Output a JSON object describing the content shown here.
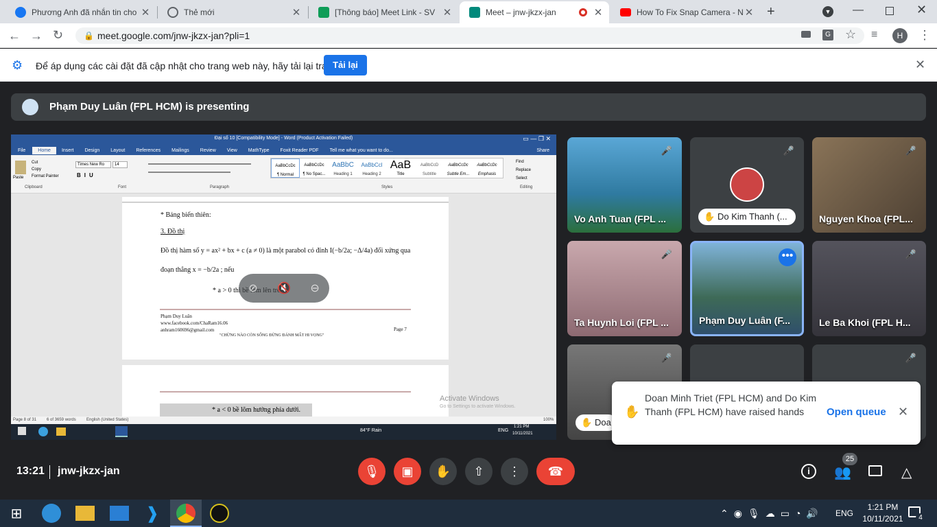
{
  "browser": {
    "tabs": [
      {
        "label": "Phương Anh đã nhắn tin cho",
        "color": "#1877f2"
      },
      {
        "label": "Thẻ mới",
        "color": "#5f6368"
      },
      {
        "label": "[Thông báo] Meet Link - SV",
        "color": "#0f9d58"
      },
      {
        "label": "Meet – jnw-jkzx-jan",
        "color": "#00897b"
      },
      {
        "label": "How To Fix Snap Camera - No",
        "color": "#ff0000"
      }
    ],
    "url": "meet.google.com/jnw-jkzx-jan?pli=1",
    "profile": "H"
  },
  "infobar": {
    "message": "Để áp dụng các cài đặt đã cập nhật cho trang web này, hãy tải lại trang",
    "button": "Tải lại"
  },
  "presenting": "Phạm Duy Luân (FPL HCM) is presenting",
  "word": {
    "title": "Đại số 10 [Compatibility Mode] - Word (Product Activation Failed)",
    "menu": [
      "File",
      "Home",
      "Insert",
      "Design",
      "Layout",
      "References",
      "Mailings",
      "Review",
      "View",
      "MathType",
      "Foxit Reader PDF",
      "Tell me what you want to do..."
    ],
    "share": "Share",
    "font": "Times New Ro",
    "size": "14",
    "styles": [
      "¶ Normal",
      "¶ No Spac...",
      "Heading 1",
      "Heading 2",
      "Title",
      "Subtitle",
      "Subtle Em...",
      "Emphasis"
    ],
    "styles_preview": [
      "AaBbCcDc",
      "AaBbCcDc",
      "AaBbC",
      "AaBbCcl",
      "AaB",
      "AaBbCcD",
      "AaBbCcDc",
      "AaBbCcDc"
    ],
    "groups": [
      "Clipboard",
      "Font",
      "Paragraph",
      "Styles",
      "Editing"
    ],
    "clipboard": [
      "Paste",
      "Cut",
      "Copy",
      "Format Painter"
    ],
    "editing": [
      "Find",
      "Replace",
      "Select"
    ],
    "doc_lines": [
      "* Bảng biến thiên:",
      "3. Đồ thị",
      "Đồ thị hàm số y = ax² + bx + c (a ≠ 0) là một parabol có đỉnh I(−b/2a; −Δ/4a) đối xứng qua",
      "đoạn thẳng x = −b/2a ; nếu",
      "* a > 0  thì bề lõm lên trên."
    ],
    "footer": [
      "Phạm Duy Luân",
      "www.facebook.com/ChaRam16.06",
      "anhram160696@gmail.com",
      "\"CHỪNG NÀO CÒN SỐNG ĐỪNG ĐÁNH MẤT HI VỌNG\"",
      "Page 7"
    ],
    "page2_line": "* a < 0   bề lõm hướng phía dưới.",
    "status": [
      "Page 8 of 31",
      "6 of 3659 words",
      "English (United States)"
    ],
    "zoom": "100%",
    "activate": [
      "Activate Windows",
      "Go to Settings to activate Windows."
    ],
    "inner_taskbar": {
      "weather": "84°F  Rain",
      "lang": "ENG",
      "time": "1:21 PM",
      "date": "10/11/2021"
    }
  },
  "participants": [
    {
      "name": "Vo Anh Tuan (FPL ...",
      "bg": "#3a8fb7"
    },
    {
      "name": "Do Kim Thanh (...",
      "bg": "#3c4043"
    },
    {
      "name": "Nguyen Khoa (FPL...",
      "bg": "#6b5a48"
    },
    {
      "name": "Ta Huynh Loi (FPL ...",
      "bg": "#a07c83"
    },
    {
      "name": "Phạm Duy Luân (F...",
      "bg": "#4f7fa0"
    },
    {
      "name": "Le Ba Khoi (FPL H...",
      "bg": "#474650"
    },
    {
      "name": "Doa",
      "bg": "#5c5c5c"
    },
    {
      "name": "",
      "bg": "#3c4043"
    },
    {
      "name": "",
      "bg": "#3c4043"
    }
  ],
  "toast": {
    "text": "Doan Minh Triet (FPL HCM) and Do Kim Thanh (FPL HCM) have raised hands",
    "action": "Open queue"
  },
  "bottom": {
    "time": "13:21",
    "code": "jnw-jkzx-jan",
    "people_count": "25"
  },
  "taskbar": {
    "lang": "ENG",
    "time": "1:21 PM",
    "date": "10/11/2021",
    "notif": "4"
  }
}
